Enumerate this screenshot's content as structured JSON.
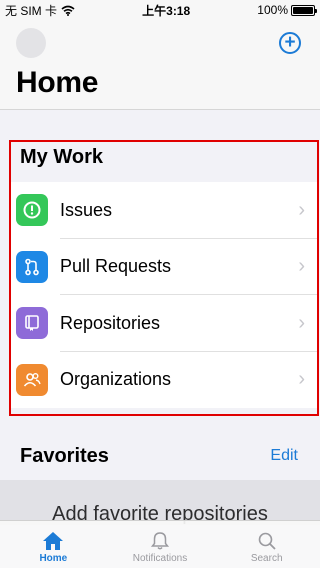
{
  "status_bar": {
    "carrier": "无 SIM 卡",
    "time": "上午3:18",
    "battery": "100%",
    "battery_level": 1.0,
    "wifi_icon": "wifi-icon"
  },
  "nav": {
    "title": "Home",
    "add_icon": "plus-circle-icon"
  },
  "my_work": {
    "header": "My Work",
    "items": [
      {
        "label": "Issues",
        "icon": "issue-icon",
        "color": "#34c759"
      },
      {
        "label": "Pull Requests",
        "icon": "pull-request-icon",
        "color": "#1e88e5"
      },
      {
        "label": "Repositories",
        "icon": "repo-icon",
        "color": "#8e6bd8"
      },
      {
        "label": "Organizations",
        "icon": "organization-icon",
        "color": "#f08a30"
      }
    ]
  },
  "favorites": {
    "header": "Favorites",
    "edit_label": "Edit",
    "placeholder": "Add favorite repositories"
  },
  "tabbar": {
    "tabs": [
      {
        "label": "Home",
        "icon": "home-icon",
        "active": true
      },
      {
        "label": "Notifications",
        "icon": "bell-icon",
        "active": false
      },
      {
        "label": "Search",
        "icon": "search-icon",
        "active": false
      }
    ]
  },
  "colors": {
    "accent": "#1c7bd6",
    "highlight": "#e00000"
  }
}
